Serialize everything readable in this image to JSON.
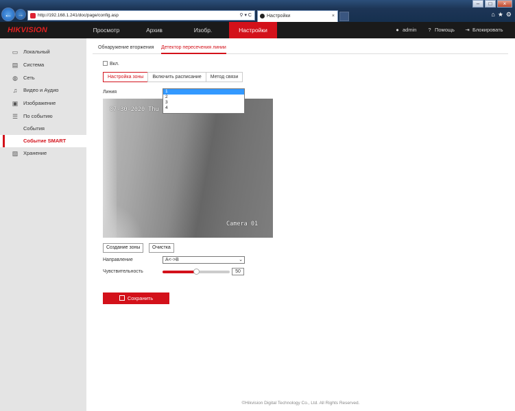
{
  "browser": {
    "url": "http://192.168.1.241/doc/page/config.asp",
    "url_tools": "⚲ ▾ C",
    "tab_title": "Настройки",
    "tab_close": "×",
    "window_buttons": [
      "–",
      "□",
      "×"
    ],
    "toolbar_icons": [
      "⌂",
      "★",
      "⚙"
    ]
  },
  "header": {
    "logo": "HIKVISION",
    "menu": [
      "Просмотр",
      "Архив",
      "Изобр.",
      "Настройки"
    ],
    "active_menu": "Настройки",
    "user": "admin",
    "help": "Помощь",
    "lock": "Блокировать"
  },
  "sidebar": {
    "items": [
      {
        "label": "Локальный",
        "icon": "monitor-icon"
      },
      {
        "label": "Система",
        "icon": "system-icon"
      },
      {
        "label": "Сеть",
        "icon": "globe-icon"
      },
      {
        "label": "Видео и Аудио",
        "icon": "video-audio-icon"
      },
      {
        "label": "Изображение",
        "icon": "image-icon"
      },
      {
        "label": "По событию",
        "icon": "event-icon"
      },
      {
        "label": "События",
        "icon": ""
      },
      {
        "label": "Событие SMART",
        "icon": ""
      },
      {
        "label": "Хранение",
        "icon": "storage-icon"
      }
    ],
    "active": "Событие SMART"
  },
  "main": {
    "tabs": [
      "Обнаружение вторжения",
      "Детектор пересечения линии"
    ],
    "active_tab": "Детектор пересечения линии",
    "enable_label": "Вкл.",
    "steps": [
      "Настройка зоны",
      "Включить расписание",
      "Метод связи"
    ],
    "active_step": "Настройка зоны",
    "line_label": "Линия",
    "line_options": [
      "1",
      "2",
      "3",
      "4"
    ],
    "line_selected": "1",
    "video": {
      "timestamp": "07-30-2020 Thu",
      "camera_name": "Camera 01"
    },
    "draw_area_button": "Создание зоны",
    "clear_button": "Очистка",
    "direction_label": "Направление",
    "direction_value": "A<->B",
    "sensitivity_label": "Чувствительность",
    "sensitivity_value": "50",
    "sensitivity_fraction": 0.5,
    "save_button": "Сохранить"
  },
  "footer": "©Hikvision Digital Technology Co., Ltd. All Rights Reserved.",
  "colors": {
    "accent": "#d3111a",
    "nav_bg": "#1a1a1a",
    "sidebar_bg": "#e4e4e4"
  }
}
